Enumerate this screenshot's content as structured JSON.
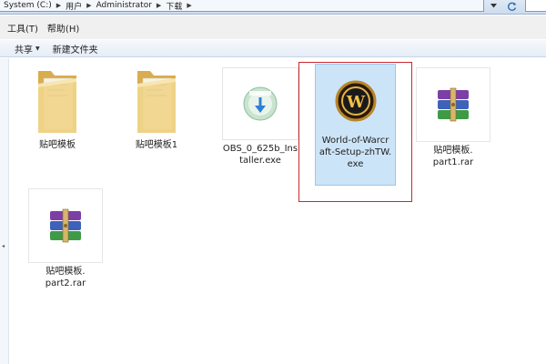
{
  "address_bar": {
    "segments": [
      "System (C:)",
      "用户",
      "Administrator",
      "下载"
    ],
    "separator": "▶"
  },
  "menu": {
    "tools": "工具(T)",
    "help": "帮助(H)"
  },
  "command_bar": {
    "share": "共享",
    "new_folder": "新建文件夹"
  },
  "files": [
    {
      "name": "贴吧模板",
      "type": "folder"
    },
    {
      "name": "贴吧模板1",
      "type": "folder"
    },
    {
      "name_line1": "OBS_0_625b_Ins",
      "name_line2": "taller.exe",
      "type": "installer"
    },
    {
      "name_line1": "World-of-Warcr",
      "name_line2": "aft-Setup-zhTW.",
      "name_line3": "exe",
      "type": "exe",
      "selected": true
    },
    {
      "name_line1": "贴吧模板.",
      "name_line2": "part1.rar",
      "type": "rar"
    },
    {
      "name_line1": "贴吧模板.",
      "name_line2": "part2.rar",
      "type": "rar"
    }
  ],
  "colors": {
    "selection": "#cce4f7",
    "highlight": "#c9292d",
    "folder": "#e9c770"
  }
}
